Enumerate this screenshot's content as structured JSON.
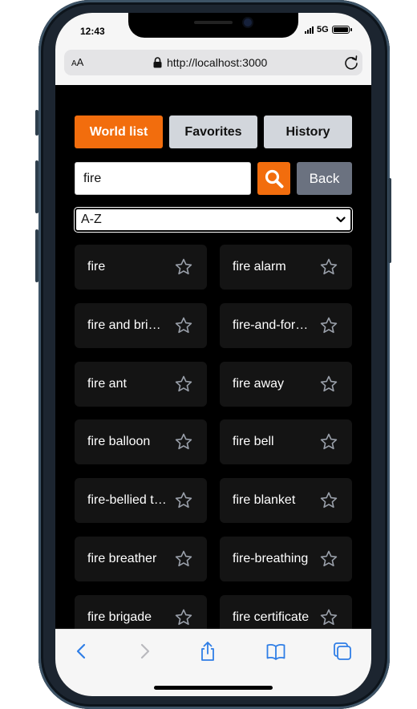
{
  "status_bar": {
    "time": "12:43",
    "network": "5G"
  },
  "browser": {
    "aa_label_small": "A",
    "aa_label_large": "A",
    "url": "http://localhost:3000"
  },
  "tabs": [
    {
      "label": "World list",
      "active": true
    },
    {
      "label": "Favorites",
      "active": false
    },
    {
      "label": "History",
      "active": false
    }
  ],
  "search": {
    "value": "fire",
    "back_label": "Back"
  },
  "sort": {
    "selected": "A-Z"
  },
  "words": [
    "fire",
    "fire alarm",
    "fire and brimstone",
    "fire-and-forget",
    "fire ant",
    "fire away",
    "fire balloon",
    "fire bell",
    "fire-bellied toad",
    "fire blanket",
    "fire breather",
    "fire-breathing",
    "fire brigade",
    "fire certificate"
  ],
  "colors": {
    "accent": "#f26d0d",
    "tab_inactive": "#d2d6dc",
    "back": "#6b7280",
    "card": "#141414"
  }
}
